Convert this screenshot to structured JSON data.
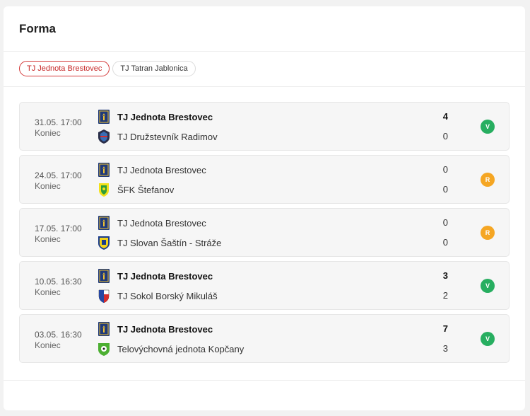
{
  "header": {
    "title": "Forma"
  },
  "tabs": [
    {
      "label": "TJ Jednota Brestovec",
      "active": true
    },
    {
      "label": "TJ Tatran Jablonica",
      "active": false
    }
  ],
  "colors": {
    "win": "#27ae60",
    "draw": "#f5a623",
    "accent": "#d43a3a"
  },
  "matches": [
    {
      "datetime": "31.05. 17:00",
      "status": "Koniec",
      "home": {
        "name": "TJ Jednota Brestovec",
        "score": "4",
        "winner": true,
        "crest": "brestovec-crest-icon"
      },
      "away": {
        "name": "TJ Družstevník Radimov",
        "score": "0",
        "winner": false,
        "crest": "radimov-crest-icon"
      },
      "result": "V",
      "result_type": "win"
    },
    {
      "datetime": "24.05. 17:00",
      "status": "Koniec",
      "home": {
        "name": "TJ Jednota Brestovec",
        "score": "0",
        "winner": false,
        "crest": "brestovec-crest-icon"
      },
      "away": {
        "name": "ŠFK Štefanov",
        "score": "0",
        "winner": false,
        "crest": "stefanov-crest-icon"
      },
      "result": "R",
      "result_type": "draw"
    },
    {
      "datetime": "17.05. 17:00",
      "status": "Koniec",
      "home": {
        "name": "TJ Jednota Brestovec",
        "score": "0",
        "winner": false,
        "crest": "brestovec-crest-icon"
      },
      "away": {
        "name": "TJ Slovan Šaštín - Stráže",
        "score": "0",
        "winner": false,
        "crest": "sastin-crest-icon"
      },
      "result": "R",
      "result_type": "draw"
    },
    {
      "datetime": "10.05. 16:30",
      "status": "Koniec",
      "home": {
        "name": "TJ Jednota Brestovec",
        "score": "3",
        "winner": true,
        "crest": "brestovec-crest-icon"
      },
      "away": {
        "name": "TJ Sokol Borský Mikuláš",
        "score": "2",
        "winner": false,
        "crest": "borsky-mikulas-crest-icon"
      },
      "result": "V",
      "result_type": "win"
    },
    {
      "datetime": "03.05. 16:30",
      "status": "Koniec",
      "home": {
        "name": "TJ Jednota Brestovec",
        "score": "7",
        "winner": true,
        "crest": "brestovec-crest-icon"
      },
      "away": {
        "name": "Telovýchovná jednota Kopčany",
        "score": "3",
        "winner": false,
        "crest": "kopcany-crest-icon"
      },
      "result": "V",
      "result_type": "win"
    }
  ]
}
